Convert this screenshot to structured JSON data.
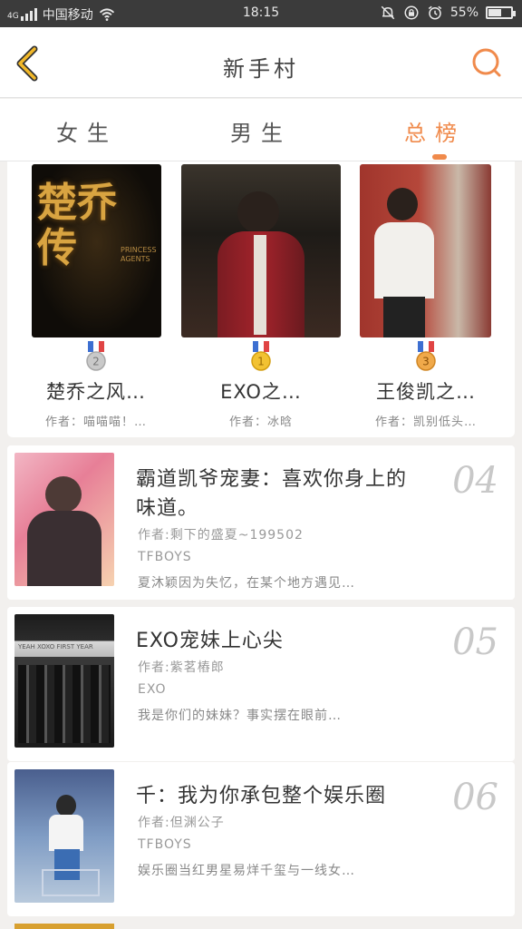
{
  "status_bar": {
    "network_badge": "4G",
    "carrier": "中国移动",
    "time": "18:15",
    "battery_percent": "55%",
    "battery_level": 0.55
  },
  "header": {
    "title": "新手村",
    "icons": {
      "back": "back-chevron-icon",
      "search": "search-icon"
    }
  },
  "tabs": [
    {
      "label": "女生",
      "active": false
    },
    {
      "label": "男生",
      "active": false
    },
    {
      "label": "总榜",
      "active": true
    }
  ],
  "colors": {
    "accent": "#f08a4b",
    "back_chevron": "#f2b829"
  },
  "podium": [
    {
      "rank": "2",
      "name": "楚乔之风…",
      "author": "作者：喵喵喵！…",
      "cover_text": "楚乔传",
      "cover_subtext": "PRINCESS AGENTS"
    },
    {
      "rank": "1",
      "name": "EXO之…",
      "author": "作者：冰晗"
    },
    {
      "rank": "3",
      "name": "王俊凯之…",
      "author": "作者：凯别低头…"
    }
  ],
  "books": [
    {
      "rank": "04",
      "title": "霸道凯爷宠妻：喜欢你身上的味道。",
      "author": "作者:剩下的盛夏~199502",
      "tag": "TFBOYS",
      "desc": "夏沐颖因为失忆，在某个地方遇见…"
    },
    {
      "rank": "05",
      "title": "EXO宠妹上心尖",
      "author": "作者:紫茗樁郎",
      "tag": "EXO",
      "desc": "我是你们的妹妹？事实摆在眼前…",
      "banner_text": "YEAH XOXO FIRST YEAR"
    },
    {
      "rank": "06",
      "title": "千：我为你承包整个娱乐圈",
      "author": "作者:但渊公子",
      "tag": "TFBOYS",
      "desc": "娱乐圈当红男星易烊千玺与一线女…"
    }
  ]
}
